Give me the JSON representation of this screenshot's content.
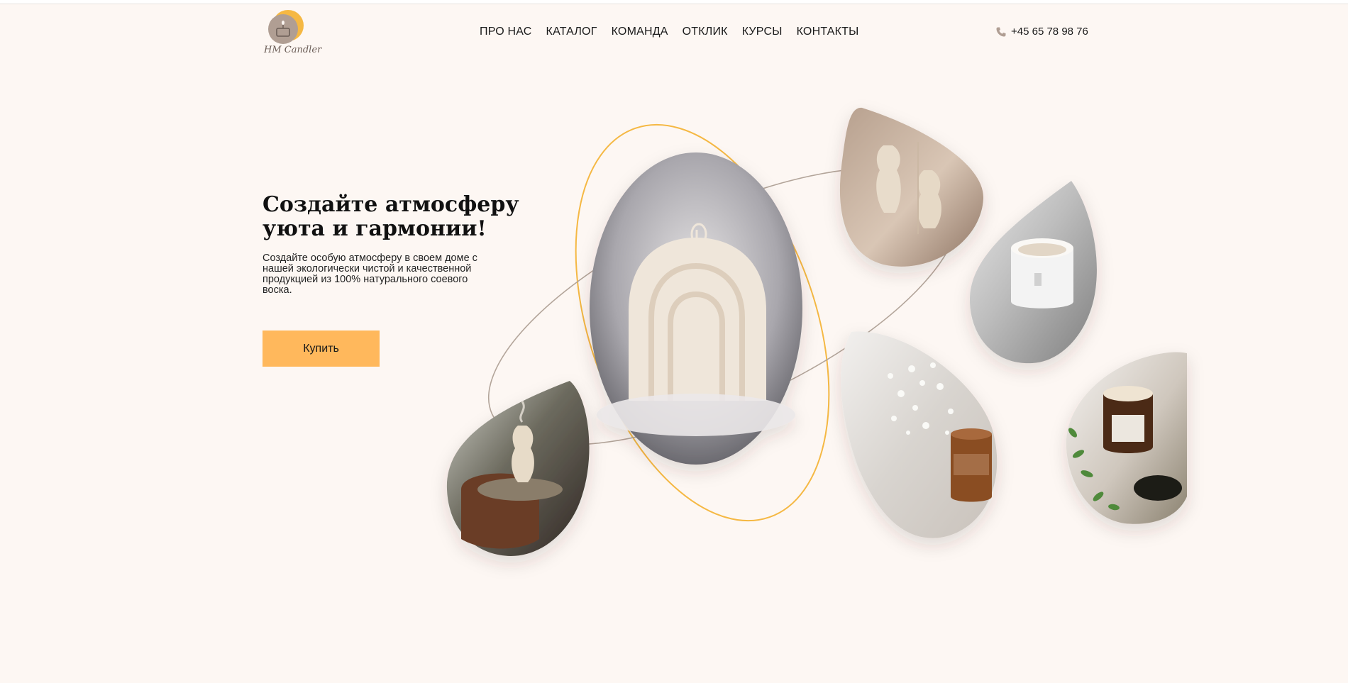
{
  "header": {
    "logo_text": "HM Candler",
    "nav": [
      {
        "label": "ПРО НАС"
      },
      {
        "label": "КАТАЛОГ"
      },
      {
        "label": "КОМАНДА"
      },
      {
        "label": "ОТКЛИК"
      },
      {
        "label": "КУРСЫ"
      },
      {
        "label": "КОНТАКТЫ"
      }
    ],
    "phone": "+45 65 78 98 76",
    "phone_icon": "phone-icon"
  },
  "hero": {
    "title_line1": "Создайте атмосферу",
    "title_line2": "уюта и гармонии!",
    "text_line1": "Создайте особую атмосферу в своем доме с",
    "text_line2": "нашей экологически чистой и качественной",
    "text_line3": "продукцией из 100% натурального соевого",
    "text_line4": "воска.",
    "buy_label": "Купить"
  },
  "colors": {
    "background": "#fdf7f3",
    "accent": "#ffb85c",
    "orbit_gold": "#f5b843",
    "orbit_taupe": "#b3a59a"
  }
}
